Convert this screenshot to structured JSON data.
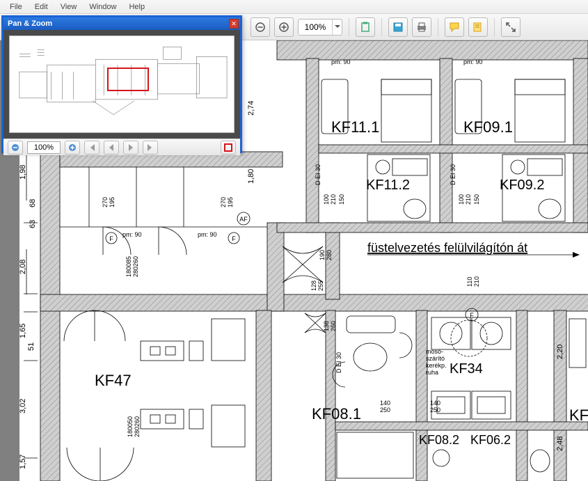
{
  "menu": {
    "file": "File",
    "edit": "Edit",
    "view": "View",
    "window": "Window",
    "help": "Help"
  },
  "toolbar": {
    "zoom": "100%"
  },
  "panzoom": {
    "title": "Pan & Zoom",
    "zoom": "100%"
  },
  "plan": {
    "annotation": "füstelvezetés felülvilágítón át",
    "rooms": {
      "kf47": "KF47",
      "kf11_1": "KF11.1",
      "kf09_1": "KF09.1",
      "kf11_2": "KF11.2",
      "kf09_2": "KF09.2",
      "kf08_1": "KF08.1",
      "kf08_2": "KF08.2",
      "kf06_2": "KF06.2",
      "kf34": "KF34",
      "kf_right": "KF"
    },
    "note": {
      "l1": "mosó-",
      "l2": "szárító",
      "l3": "kerékp.",
      "l4": "ruha"
    },
    "dims": {
      "d198": "1,98",
      "d208": "2,08",
      "d274": "2,74",
      "d180": "1,80",
      "d165": "1,65",
      "d51": "51",
      "d302": "3,02",
      "d157": "1,57",
      "d63": "63",
      "d68": "68",
      "d220": "2,20",
      "d248": "2,48",
      "d270": "270",
      "d195": "195",
      "d180085": "180085",
      "d280260": "280260",
      "d180050": "180050",
      "d140": "140",
      "d250": "250",
      "d110": "110",
      "d210": "210",
      "d100": "100",
      "d190": "190",
      "d280": "280",
      "d128": "128",
      "d255": "255",
      "d138": "138",
      "d260": "260",
      "d150": "150",
      "pm90": "pm: 90",
      "dei30": "D EI 30"
    },
    "markers": {
      "f": "F",
      "af": "AF"
    }
  }
}
